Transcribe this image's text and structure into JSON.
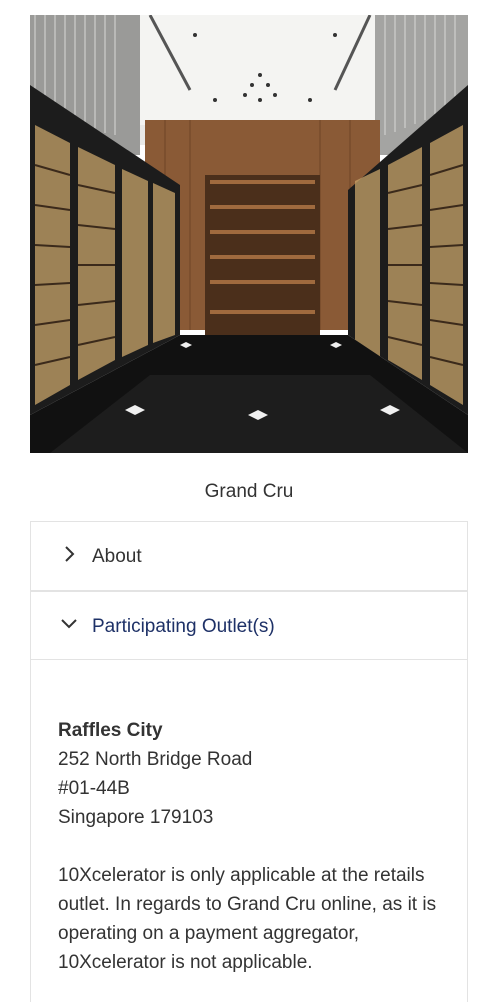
{
  "hero": {
    "icon": "wine-cellar-photo"
  },
  "store": {
    "name": "Grand Cru"
  },
  "accordion": {
    "about": {
      "label": "About",
      "state": "collapsed",
      "icon": "chevron-right-icon"
    },
    "outlets": {
      "label": "Participating Outlet(s)",
      "state": "expanded",
      "icon": "chevron-down-icon",
      "color": "#1e3167",
      "outlet": {
        "name": "Raffles City",
        "address1": "252 North Bridge Road",
        "address2": "#01-44B",
        "address3": "Singapore 179103"
      },
      "note": "10Xcelerator is only applicable at the retails outlet. In regards to Grand Cru online, as it is operating on a payment aggregator, 10Xcelerator is not applicable."
    }
  }
}
